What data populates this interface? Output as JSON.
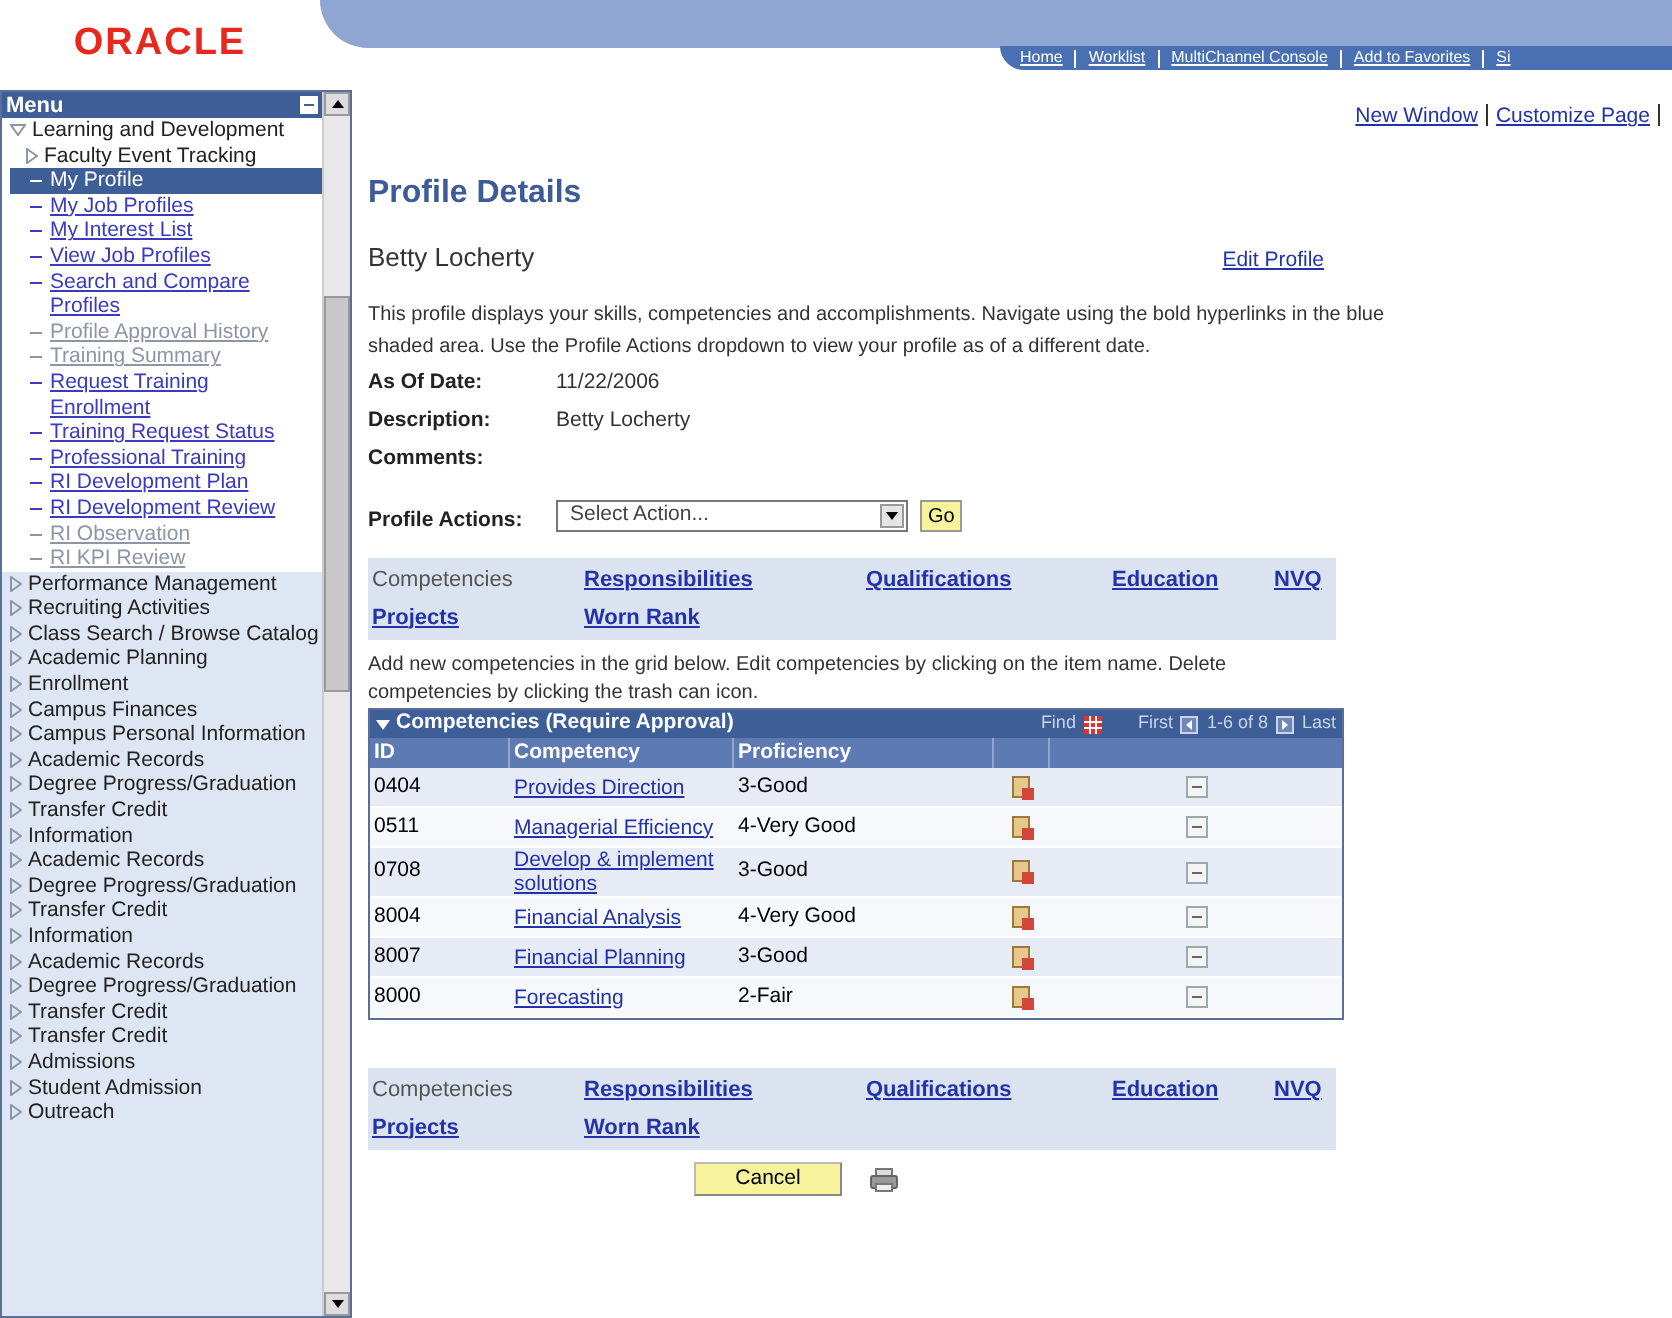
{
  "header": {
    "logo": "ORACLE",
    "links": [
      "Home",
      "Worklist",
      "MultiChannel Console",
      "Add to Favorites",
      "Si"
    ]
  },
  "menu": {
    "title": "Menu",
    "items": [
      {
        "label": "Learning and Development",
        "kind": "folder",
        "expanded": true,
        "children": [
          {
            "label": "Faculty Event Tracking",
            "kind": "folder",
            "expanded": false
          },
          {
            "label": "My Profile",
            "kind": "link",
            "selected": true,
            "disabled": false
          },
          {
            "label": "My Job Profiles",
            "kind": "link",
            "selected": false,
            "disabled": false
          },
          {
            "label": "My Interest List",
            "kind": "link",
            "selected": false,
            "disabled": false
          },
          {
            "label": "View Job Profiles",
            "kind": "link",
            "selected": false,
            "disabled": false
          },
          {
            "label": "Search and Compare Profiles",
            "kind": "link",
            "selected": false,
            "disabled": false
          },
          {
            "label": "Profile Approval History",
            "kind": "link",
            "selected": false,
            "disabled": true
          },
          {
            "label": "Training Summary",
            "kind": "link",
            "selected": false,
            "disabled": true
          },
          {
            "label": "Request Training Enrollment",
            "kind": "link",
            "selected": false,
            "disabled": false
          },
          {
            "label": "Training Request Status",
            "kind": "link",
            "selected": false,
            "disabled": false
          },
          {
            "label": "Professional Training",
            "kind": "link",
            "selected": false,
            "disabled": false
          },
          {
            "label": "RI Development Plan",
            "kind": "link",
            "selected": false,
            "disabled": false
          },
          {
            "label": "RI Development Review",
            "kind": "link",
            "selected": false,
            "disabled": false
          },
          {
            "label": "RI Observation",
            "kind": "link",
            "selected": false,
            "disabled": true
          },
          {
            "label": "RI KPI Review",
            "kind": "link",
            "selected": false,
            "disabled": true
          }
        ]
      },
      {
        "label": "Performance Management",
        "kind": "folder",
        "expanded": false
      },
      {
        "label": "Recruiting Activities",
        "kind": "folder",
        "expanded": false
      },
      {
        "label": "Class Search / Browse Catalog",
        "kind": "folder",
        "expanded": false
      },
      {
        "label": "Academic Planning",
        "kind": "folder",
        "expanded": false
      },
      {
        "label": "Enrollment",
        "kind": "folder",
        "expanded": false
      },
      {
        "label": "Campus Finances",
        "kind": "folder",
        "expanded": false
      },
      {
        "label": "Campus Personal Information",
        "kind": "folder",
        "expanded": false
      },
      {
        "label": "Academic Records",
        "kind": "folder",
        "expanded": false
      },
      {
        "label": "Degree Progress/Graduation",
        "kind": "folder",
        "expanded": false
      },
      {
        "label": "Transfer Credit",
        "kind": "folder",
        "expanded": false
      },
      {
        "label": "Information",
        "kind": "folder",
        "expanded": false
      },
      {
        "label": "Academic Records",
        "kind": "folder",
        "expanded": false
      },
      {
        "label": "Degree Progress/Graduation",
        "kind": "folder",
        "expanded": false
      },
      {
        "label": "Transfer Credit",
        "kind": "folder",
        "expanded": false
      },
      {
        "label": "Information",
        "kind": "folder",
        "expanded": false
      },
      {
        "label": "Academic Records",
        "kind": "folder",
        "expanded": false
      },
      {
        "label": "Degree Progress/Graduation",
        "kind": "folder",
        "expanded": false
      },
      {
        "label": "Transfer Credit",
        "kind": "folder",
        "expanded": false
      },
      {
        "label": "Transfer Credit",
        "kind": "folder",
        "expanded": false
      },
      {
        "label": "Admissions",
        "kind": "folder",
        "expanded": false
      },
      {
        "label": "Student Admission",
        "kind": "folder",
        "expanded": false
      },
      {
        "label": "Outreach",
        "kind": "folder",
        "expanded": false
      }
    ]
  },
  "page_links": [
    "New Window",
    "Customize Page"
  ],
  "page": {
    "title": "Profile Details",
    "name": "Betty Locherty",
    "edit_link": "Edit Profile",
    "intro": "This profile displays your skills, competencies and accomplishments.  Navigate using the bold hyperlinks in the blue shaded area.  Use the Profile Actions dropdown to view your profile as of a different date.",
    "fields": [
      {
        "label": "As Of Date:",
        "value": "11/22/2006"
      },
      {
        "label": "Description:",
        "value": "Betty Locherty"
      },
      {
        "label": "Comments:"
      }
    ],
    "actions": {
      "label": "Profile Actions:",
      "value": "Select Action...",
      "go": "Go"
    }
  },
  "nav_top": [
    {
      "label": "Competencies",
      "selected": true
    },
    {
      "label": "Responsibilities",
      "selected": false
    },
    {
      "label": "Qualifications",
      "selected": false
    },
    {
      "label": "Education",
      "selected": false
    },
    {
      "label": "NVQ",
      "selected": false
    },
    {
      "label": "Projects",
      "selected": false
    },
    {
      "label": "Worn Rank",
      "selected": false
    }
  ],
  "grid_note": "Add new competencies in the grid below.  Edit competencies by clicking on the item name.  Delete competencies by clicking the trash can icon.",
  "grid": {
    "title": "Competencies (Require Approval)",
    "find": "Find",
    "first": "First",
    "range": "1-6 of 8",
    "last": "Last",
    "columns": [
      "ID",
      "Competency",
      "Proficiency"
    ],
    "rows": [
      {
        "id": "0404",
        "competency": "Provides Direction",
        "proficiency": "3-Good"
      },
      {
        "id": "0511",
        "competency": "Managerial Efficiency",
        "proficiency": "4-Very Good"
      },
      {
        "id": "0708",
        "competency": "Develop & implement solutions",
        "proficiency": "3-Good"
      },
      {
        "id": "8004",
        "competency": "Financial Analysis",
        "proficiency": "4-Very Good"
      },
      {
        "id": "8007",
        "competency": "Financial Planning",
        "proficiency": "3-Good"
      },
      {
        "id": "8000",
        "competency": "Forecasting",
        "proficiency": "2-Fair"
      }
    ]
  },
  "nav_bottom": [
    {
      "label": "Competencies",
      "selected": true
    },
    {
      "label": "Responsibilities",
      "selected": false
    },
    {
      "label": "Qualifications",
      "selected": false
    },
    {
      "label": "Education",
      "selected": false
    },
    {
      "label": "NVQ",
      "selected": false
    },
    {
      "label": "Projects",
      "selected": false
    },
    {
      "label": "Worn Rank",
      "selected": false
    }
  ],
  "cancel": "Cancel"
}
